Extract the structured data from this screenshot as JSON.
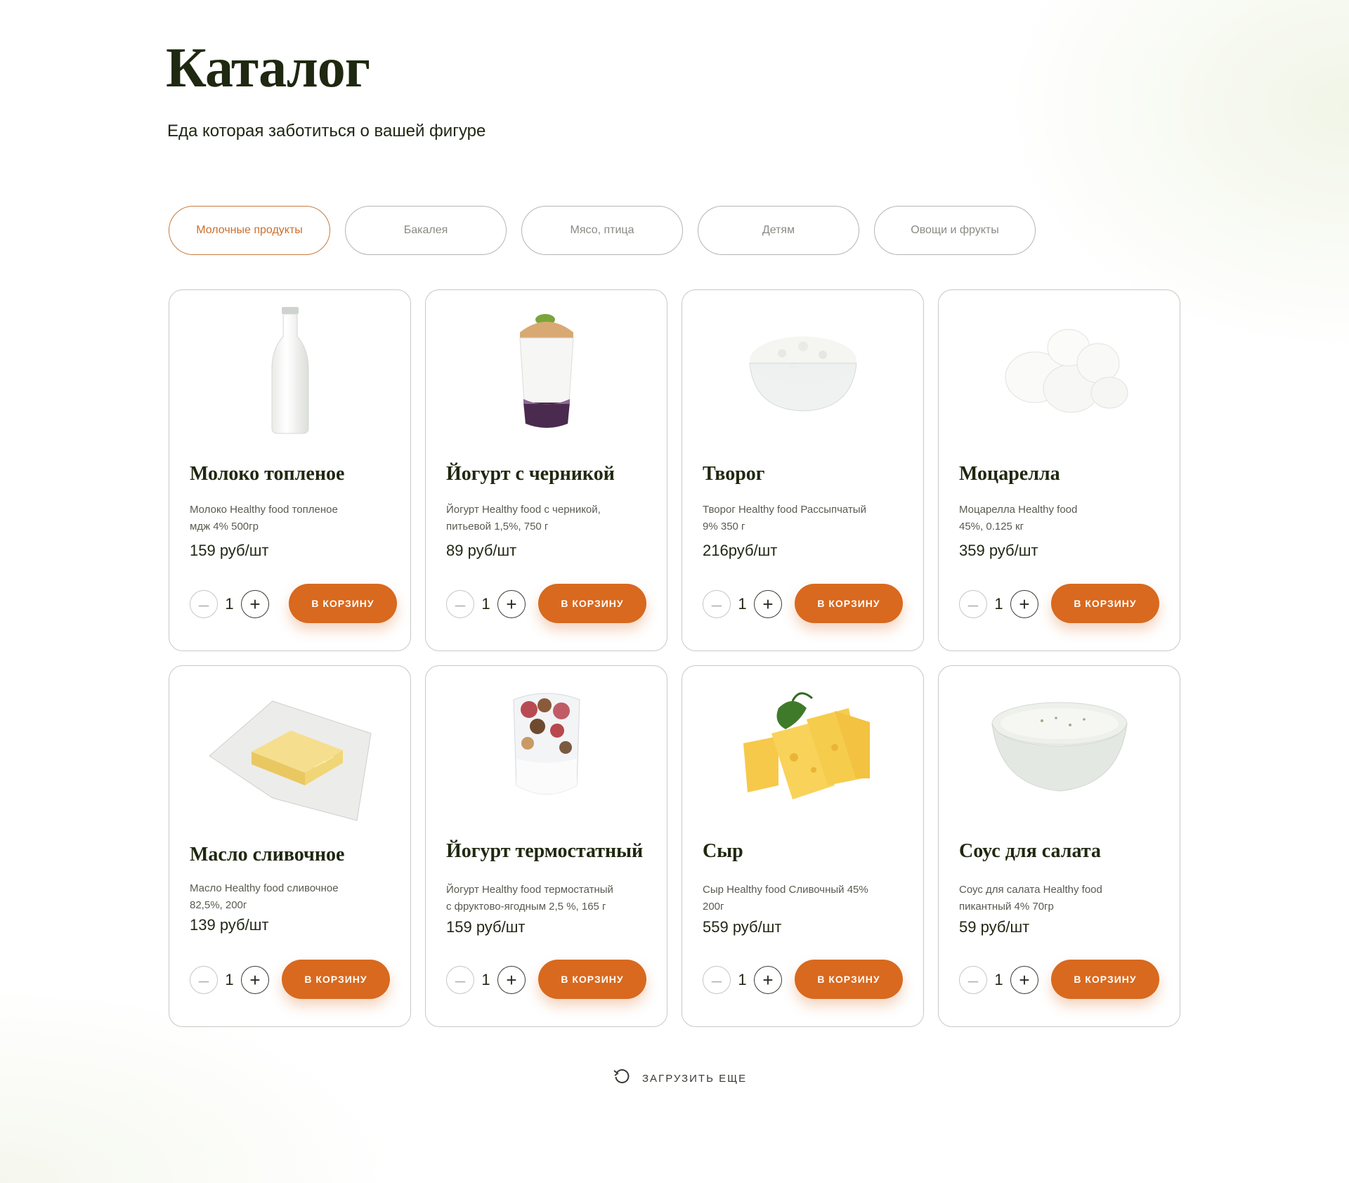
{
  "header": {
    "title": "Каталог",
    "subtitle": "Еда которая заботиться о вашей фигуре"
  },
  "filters": [
    {
      "label": "Молочные продукты",
      "active": true
    },
    {
      "label": "Бакалея",
      "active": false
    },
    {
      "label": "Мясо, птица",
      "active": false
    },
    {
      "label": "Детям",
      "active": false
    },
    {
      "label": "Овощи и фрукты",
      "active": false
    }
  ],
  "products": [
    {
      "title": "Молоко топленое",
      "desc": "Молоко Healthy food топленое\nмдж 4%   500гр",
      "price": "159 руб/шт",
      "qty": "1",
      "cart_label": "В КОРЗИНУ",
      "image": "milk-bottle-image"
    },
    {
      "title": "Йогурт с черникой",
      "desc": "Йогурт Healthy food  с черникой,\nпитьевой 1,5%, 750 г",
      "price": "89 руб/шт",
      "qty": "1",
      "cart_label": "В КОРЗИНУ",
      "image": "blueberry-yogurt-image"
    },
    {
      "title": "Творог",
      "desc": "Творог Healthy food Рассыпчатый\n9% 350 г",
      "price": "216руб/шт",
      "qty": "1",
      "cart_label": "В КОРЗИНУ",
      "image": "cottage-cheese-image"
    },
    {
      "title": "Моцарелла",
      "desc": "Моцарелла Healthy food\n45%, 0.125 кг",
      "price": "359 руб/шт",
      "qty": "1",
      "cart_label": "В КОРЗИНУ",
      "image": "mozzarella-image"
    },
    {
      "title": "Масло сливочное",
      "desc": "Масло Healthy food  сливочное\n82,5%, 200г",
      "price": "139 руб/шт",
      "qty": "1",
      "cart_label": "В КОРЗИНУ",
      "image": "butter-image"
    },
    {
      "title": "Йогурт термостатный",
      "desc": "Йогурт Healthy food термостатный\nс фруктово-ягодным 2,5 %, 165 г",
      "price": "159 руб/шт",
      "qty": "1",
      "cart_label": "В КОРЗИНУ",
      "image": "fruit-yogurt-image"
    },
    {
      "title": "Сыр",
      "desc": "Сыр  Healthy food Сливочный 45%\n200г",
      "price": "559 руб/шт",
      "qty": "1",
      "cart_label": "В КОРЗИНУ",
      "image": "cheese-image"
    },
    {
      "title": "Соус для салата",
      "desc": "Соус для салата Healthy food\nпикантный 4%  70гр",
      "price": "59 руб/шт",
      "qty": "1",
      "cart_label": "В КОРЗИНУ",
      "image": "salad-sauce-image"
    }
  ],
  "load_more": {
    "label": "ЗАГРУЗИТЬ ЕЩЕ",
    "icon": "refresh-icon"
  },
  "colors": {
    "accent": "#d8691f",
    "active_filter": "#c9702e",
    "title": "#1f2810"
  }
}
